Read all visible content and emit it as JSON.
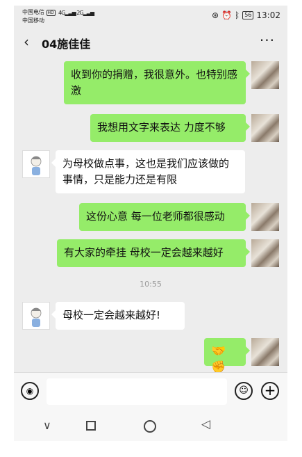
{
  "status_bar": {
    "carrier1": "中国电信",
    "carrier1_badge": "HD",
    "carrier2": "中国移动",
    "signal1": "4G",
    "signal2": "2G",
    "battery": "56",
    "time": "13:02"
  },
  "title_bar": {
    "back_icon": "‹",
    "title": "04施佳佳",
    "more_icon": "···"
  },
  "messages": [
    {
      "sender": "self",
      "text": "收到你的捐赠，我很意外。也特别感激"
    },
    {
      "sender": "self",
      "text": "我想用文字来表达 力度不够"
    },
    {
      "sender": "other",
      "text": "为母校做点事，这也是我们应该做的事情，只是能力还是有限"
    },
    {
      "sender": "self",
      "text": "这份心意 每一位老师都很感动"
    },
    {
      "sender": "self",
      "text": "有大家的牵挂 母校一定会越来越好"
    },
    {
      "sender": "time",
      "text": "10:55"
    },
    {
      "sender": "other",
      "text": "母校一定会越来越好!"
    },
    {
      "sender": "self",
      "text": "🤝✊"
    }
  ],
  "input_bar": {
    "placeholder": "",
    "voice_icon": "voice-icon",
    "emoji_icon": "emoji-icon",
    "plus_icon": "plus-icon"
  },
  "nav_bar": {
    "back": "triangle-back-icon",
    "home": "circle-home-icon",
    "recent": "square-recent-icon"
  }
}
